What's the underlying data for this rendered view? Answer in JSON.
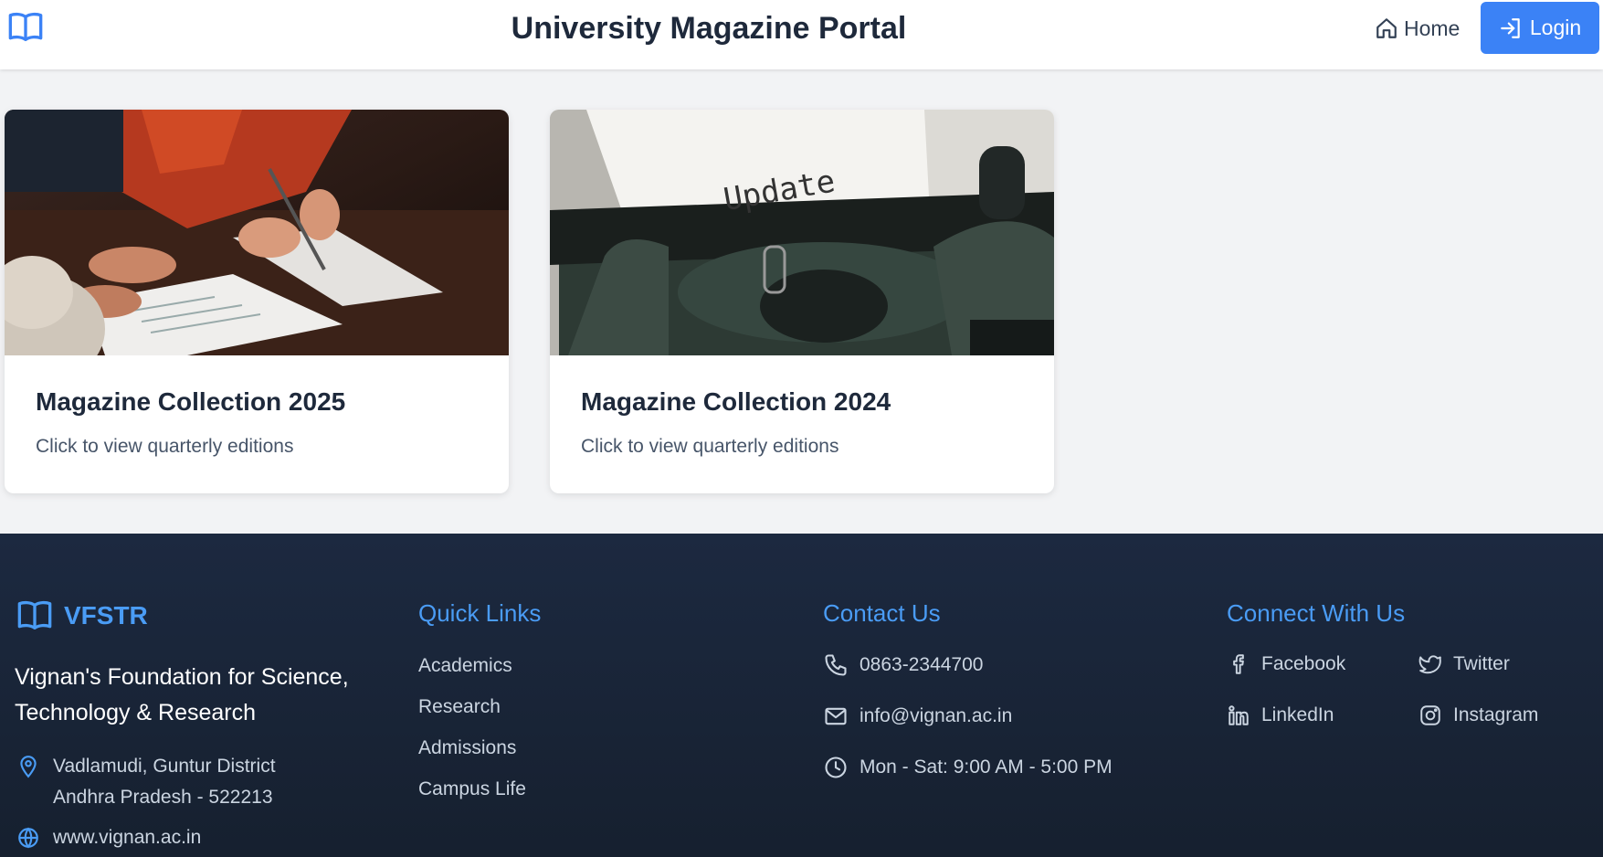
{
  "header": {
    "title": "University Magazine Portal",
    "home_label": "Home",
    "login_label": "Login"
  },
  "cards": [
    {
      "title": "Magazine Collection 2025",
      "subtitle": "Click to view quarterly editions"
    },
    {
      "title": "Magazine Collection 2024",
      "subtitle": "Click to view quarterly editions",
      "image_text": "Update"
    }
  ],
  "footer": {
    "brand": "VFSTR",
    "institution": "Vignan's Foundation for Science, Technology & Research",
    "address_line1": "Vadlamudi, Guntur District",
    "address_line2": "Andhra Pradesh - 522213",
    "website": "www.vignan.ac.in",
    "quick_links": {
      "heading": "Quick Links",
      "items": [
        "Academics",
        "Research",
        "Admissions",
        "Campus Life"
      ]
    },
    "contact": {
      "heading": "Contact Us",
      "phone": "0863-2344700",
      "email": "info@vignan.ac.in",
      "hours": "Mon - Sat: 9:00 AM - 5:00 PM"
    },
    "connect": {
      "heading": "Connect With Us",
      "facebook": "Facebook",
      "twitter": "Twitter",
      "linkedin": "LinkedIn",
      "instagram": "Instagram"
    }
  },
  "colors": {
    "accent": "#3b82f6",
    "footer_heading": "#4a9cf5",
    "footer_bg": "#1c2940"
  }
}
